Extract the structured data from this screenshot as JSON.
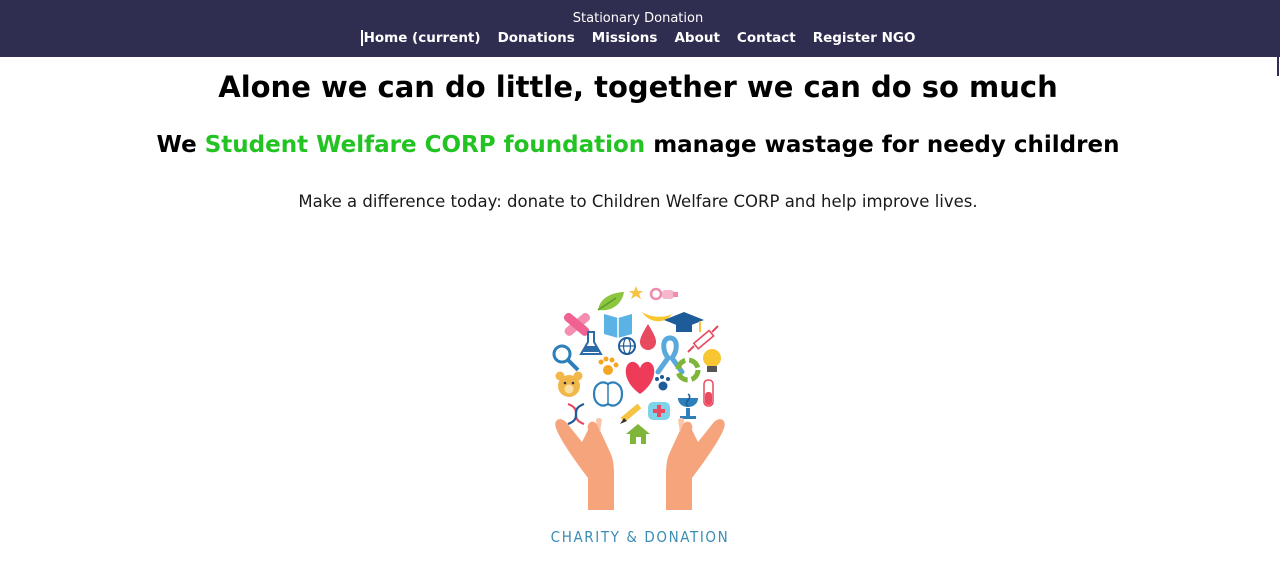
{
  "nav": {
    "brand": "Stationary Donation",
    "links": [
      {
        "label": "Home (current)"
      },
      {
        "label": "Donations"
      },
      {
        "label": "Missions"
      },
      {
        "label": "About"
      },
      {
        "label": "Contact"
      },
      {
        "label": "Register NGO"
      }
    ],
    "bg_color": "#2f2e51"
  },
  "hero": {
    "heading": "Alone we can do little, together we can do so much",
    "subheading": {
      "prefix": "We ",
      "highlight": "Student Welfare CORP foundation",
      "suffix": " manage wastage for needy children",
      "highlight_color": "#22c322"
    },
    "lead": "Make a difference today: donate to Children Welfare CORP and help improve lives."
  },
  "logo": {
    "caption": "CHARITY & DONATION",
    "icons": [
      "hands-icon",
      "heart-icon",
      "book-icon",
      "leaf-icon",
      "star-icon",
      "pacifier-icon",
      "graduation-cap-icon",
      "magnifier-icon",
      "flask-icon",
      "globe-icon",
      "awareness-ribbon-icon",
      "syringe-icon",
      "lightbulb-icon",
      "teddy-bear-icon",
      "paw-icon",
      "recycle-icon",
      "brain-icon",
      "pencil-icon",
      "first-aid-kit-icon",
      "pharmacy-icon",
      "test-tube-icon",
      "dna-icon",
      "house-icon",
      "blood-drop-icon",
      "bandage-icon"
    ]
  }
}
